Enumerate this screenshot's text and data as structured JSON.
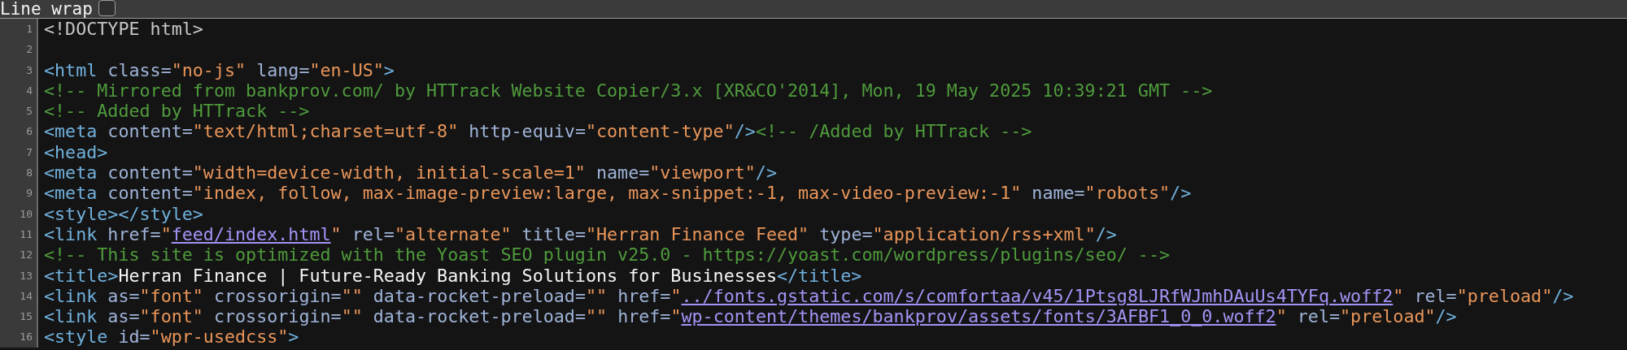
{
  "toolbar": {
    "label": "Line wrap",
    "checked": false
  },
  "lines": [
    {
      "number": "1",
      "tokens": [
        {
          "kind": "doctype",
          "text": "<!DOCTYPE html>"
        }
      ]
    },
    {
      "number": "2"
    },
    {
      "number": "3",
      "tokens": [
        {
          "kind": "tag",
          "text": "<html"
        },
        {
          "kind": "attr",
          "text": " class="
        },
        {
          "kind": "value",
          "text": "\"no-js\""
        },
        {
          "kind": "attr",
          "text": " lang="
        },
        {
          "kind": "value",
          "text": "\"en-US\""
        },
        {
          "kind": "tag",
          "text": ">"
        }
      ]
    },
    {
      "number": "4",
      "tokens": [
        {
          "kind": "comment",
          "text": "<!-- Mirrored from bankprov.com/ by HTTrack Website Copier/3.x [XR&CO'2014], Mon, 19 May 2025 10:39:21 GMT -->"
        }
      ]
    },
    {
      "number": "5",
      "tokens": [
        {
          "kind": "comment",
          "text": "<!-- Added by HTTrack -->"
        }
      ]
    },
    {
      "number": "6",
      "tokens": [
        {
          "kind": "tag",
          "text": "<meta"
        },
        {
          "kind": "attr",
          "text": " content="
        },
        {
          "kind": "value",
          "text": "\"text/html;charset=utf-8\""
        },
        {
          "kind": "attr",
          "text": " http-equiv="
        },
        {
          "kind": "value",
          "text": "\"content-type\""
        },
        {
          "kind": "tag",
          "text": "/>"
        },
        {
          "kind": "comment",
          "text": "<!-- /Added by HTTrack -->"
        }
      ]
    },
    {
      "number": "7",
      "tokens": [
        {
          "kind": "tag",
          "text": "<head>"
        }
      ]
    },
    {
      "number": "8",
      "tokens": [
        {
          "kind": "tag",
          "text": "<meta"
        },
        {
          "kind": "attr",
          "text": " content="
        },
        {
          "kind": "value",
          "text": "\"width=device-width, initial-scale=1\""
        },
        {
          "kind": "attr",
          "text": " name="
        },
        {
          "kind": "value",
          "text": "\"viewport\""
        },
        {
          "kind": "tag",
          "text": "/>"
        }
      ]
    },
    {
      "number": "9",
      "tokens": [
        {
          "kind": "tag",
          "text": "<meta"
        },
        {
          "kind": "attr",
          "text": " content="
        },
        {
          "kind": "value",
          "text": "\"index, follow, max-image-preview:large, max-snippet:-1, max-video-preview:-1\""
        },
        {
          "kind": "attr",
          "text": " name="
        },
        {
          "kind": "value",
          "text": "\"robots\""
        },
        {
          "kind": "tag",
          "text": "/>"
        }
      ]
    },
    {
      "number": "10",
      "tokens": [
        {
          "kind": "tag",
          "text": "<style></style>"
        }
      ]
    },
    {
      "number": "11",
      "tokens": [
        {
          "kind": "tag",
          "text": "<link"
        },
        {
          "kind": "attr",
          "text": " href="
        },
        {
          "kind": "value",
          "text": "\""
        },
        {
          "kind": "link",
          "text": "feed/index.html"
        },
        {
          "kind": "value",
          "text": "\""
        },
        {
          "kind": "attr",
          "text": " rel="
        },
        {
          "kind": "value",
          "text": "\"alternate\""
        },
        {
          "kind": "attr",
          "text": " title="
        },
        {
          "kind": "value",
          "text": "\"Herran Finance Feed\""
        },
        {
          "kind": "attr",
          "text": " type="
        },
        {
          "kind": "value",
          "text": "\"application/rss+xml\""
        },
        {
          "kind": "tag",
          "text": "/>"
        }
      ]
    },
    {
      "number": "12",
      "tokens": [
        {
          "kind": "comment",
          "text": "<!-- This site is optimized with the Yoast SEO plugin v25.0 - https://yoast.com/wordpress/plugins/seo/ -->"
        }
      ]
    },
    {
      "number": "13",
      "tokens": [
        {
          "kind": "tag",
          "text": "<title>"
        },
        {
          "kind": "text",
          "text": "Herran Finance | Future-Ready Banking Solutions for Businesses"
        },
        {
          "kind": "tag",
          "text": "</title>"
        }
      ]
    },
    {
      "number": "14",
      "tokens": [
        {
          "kind": "tag",
          "text": "<link"
        },
        {
          "kind": "attr",
          "text": " as="
        },
        {
          "kind": "value",
          "text": "\"font\""
        },
        {
          "kind": "attr",
          "text": " crossorigin="
        },
        {
          "kind": "value",
          "text": "\"\""
        },
        {
          "kind": "attr",
          "text": " data-rocket-preload="
        },
        {
          "kind": "value",
          "text": "\"\""
        },
        {
          "kind": "attr",
          "text": " href="
        },
        {
          "kind": "value",
          "text": "\""
        },
        {
          "kind": "link",
          "text": "../fonts.gstatic.com/s/comfortaa/v45/1Ptsg8LJRfWJmhDAuUs4TYFq.woff2"
        },
        {
          "kind": "value",
          "text": "\""
        },
        {
          "kind": "attr",
          "text": " rel="
        },
        {
          "kind": "value",
          "text": "\"preload\""
        },
        {
          "kind": "tag",
          "text": "/>"
        }
      ]
    },
    {
      "number": "15",
      "tokens": [
        {
          "kind": "tag",
          "text": "<link"
        },
        {
          "kind": "attr",
          "text": " as="
        },
        {
          "kind": "value",
          "text": "\"font\""
        },
        {
          "kind": "attr",
          "text": " crossorigin="
        },
        {
          "kind": "value",
          "text": "\"\""
        },
        {
          "kind": "attr",
          "text": " data-rocket-preload="
        },
        {
          "kind": "value",
          "text": "\"\""
        },
        {
          "kind": "attr",
          "text": " href="
        },
        {
          "kind": "value",
          "text": "\""
        },
        {
          "kind": "link",
          "text": "wp-content/themes/bankprov/assets/fonts/3AFBF1_0_0.woff2"
        },
        {
          "kind": "value",
          "text": "\""
        },
        {
          "kind": "attr",
          "text": " rel="
        },
        {
          "kind": "value",
          "text": "\"preload\""
        },
        {
          "kind": "tag",
          "text": "/>"
        }
      ]
    },
    {
      "number": "16",
      "tokens": [
        {
          "kind": "tag",
          "text": "<style"
        },
        {
          "kind": "attr",
          "text": " id="
        },
        {
          "kind": "value",
          "text": "\"wpr-usedcss\""
        },
        {
          "kind": "tag",
          "text": ">"
        }
      ]
    }
  ]
}
